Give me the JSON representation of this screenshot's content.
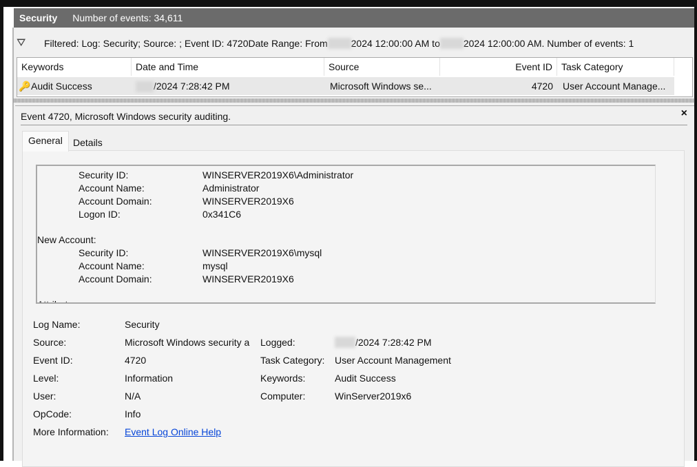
{
  "titlebar": {
    "log": "Security",
    "count": "Number of events: 34,611"
  },
  "filter": {
    "icon": "filter-icon",
    "text1": "Filtered: Log: Security; Source: ; Event ID: 4720Date Range: From ",
    "text2": "2024 12:00:00 AM to ",
    "text3": "2024 12:00:00 AM. Number of events: 1"
  },
  "table": {
    "columns": [
      "Keywords",
      "Date and Time",
      "Source",
      "Event ID",
      "Task Category"
    ],
    "rows": [
      {
        "keywords": "Audit Success",
        "date": "/2024 7:28:42 PM",
        "source": "Microsoft Windows se...",
        "event_id": "4720",
        "task": "User Account Manage..."
      }
    ]
  },
  "detail": {
    "title": "Event 4720, Microsoft Windows security auditing.",
    "close": "×",
    "tabs": [
      "General",
      "Details"
    ],
    "description": [
      {
        "label": "Security ID:",
        "value": "WINSERVER2019X6\\Administrator",
        "indent": true
      },
      {
        "label": "Account Name:",
        "value": "Administrator",
        "indent": true
      },
      {
        "label": "Account Domain:",
        "value": "WINSERVER2019X6",
        "indent": true
      },
      {
        "label": "Logon ID:",
        "value": "0x341C6",
        "indent": true
      },
      {
        "label": "New Account:",
        "value": "",
        "indent": false
      },
      {
        "label": "Security ID:",
        "value": "WINSERVER2019X6\\mysql",
        "indent": true
      },
      {
        "label": "Account Name:",
        "value": "mysql",
        "indent": true
      },
      {
        "label": "Account Domain:",
        "value": "WINSERVER2019X6",
        "indent": true
      },
      {
        "label": "Attributes:",
        "value": "",
        "indent": false
      }
    ],
    "fields": {
      "log_name": {
        "label": "Log Name:",
        "value": "Security"
      },
      "source": {
        "label": "Source:",
        "value": "Microsoft Windows security a"
      },
      "event_id": {
        "label": "Event ID:",
        "value": "4720"
      },
      "level": {
        "label": "Level:",
        "value": "Information"
      },
      "user": {
        "label": "User:",
        "value": "N/A"
      },
      "opcode": {
        "label": "OpCode:",
        "value": "Info"
      },
      "more_info": {
        "label": "More Information:",
        "value": "Event Log Online Help"
      },
      "logged": {
        "label": "Logged:",
        "value": "/2024 7:28:42 PM"
      },
      "task_category": {
        "label": "Task Category:",
        "value": "User Account Management"
      },
      "keywords": {
        "label": "Keywords:",
        "value": "Audit Success"
      },
      "computer": {
        "label": "Computer:",
        "value": "WinServer2019x6"
      }
    }
  }
}
